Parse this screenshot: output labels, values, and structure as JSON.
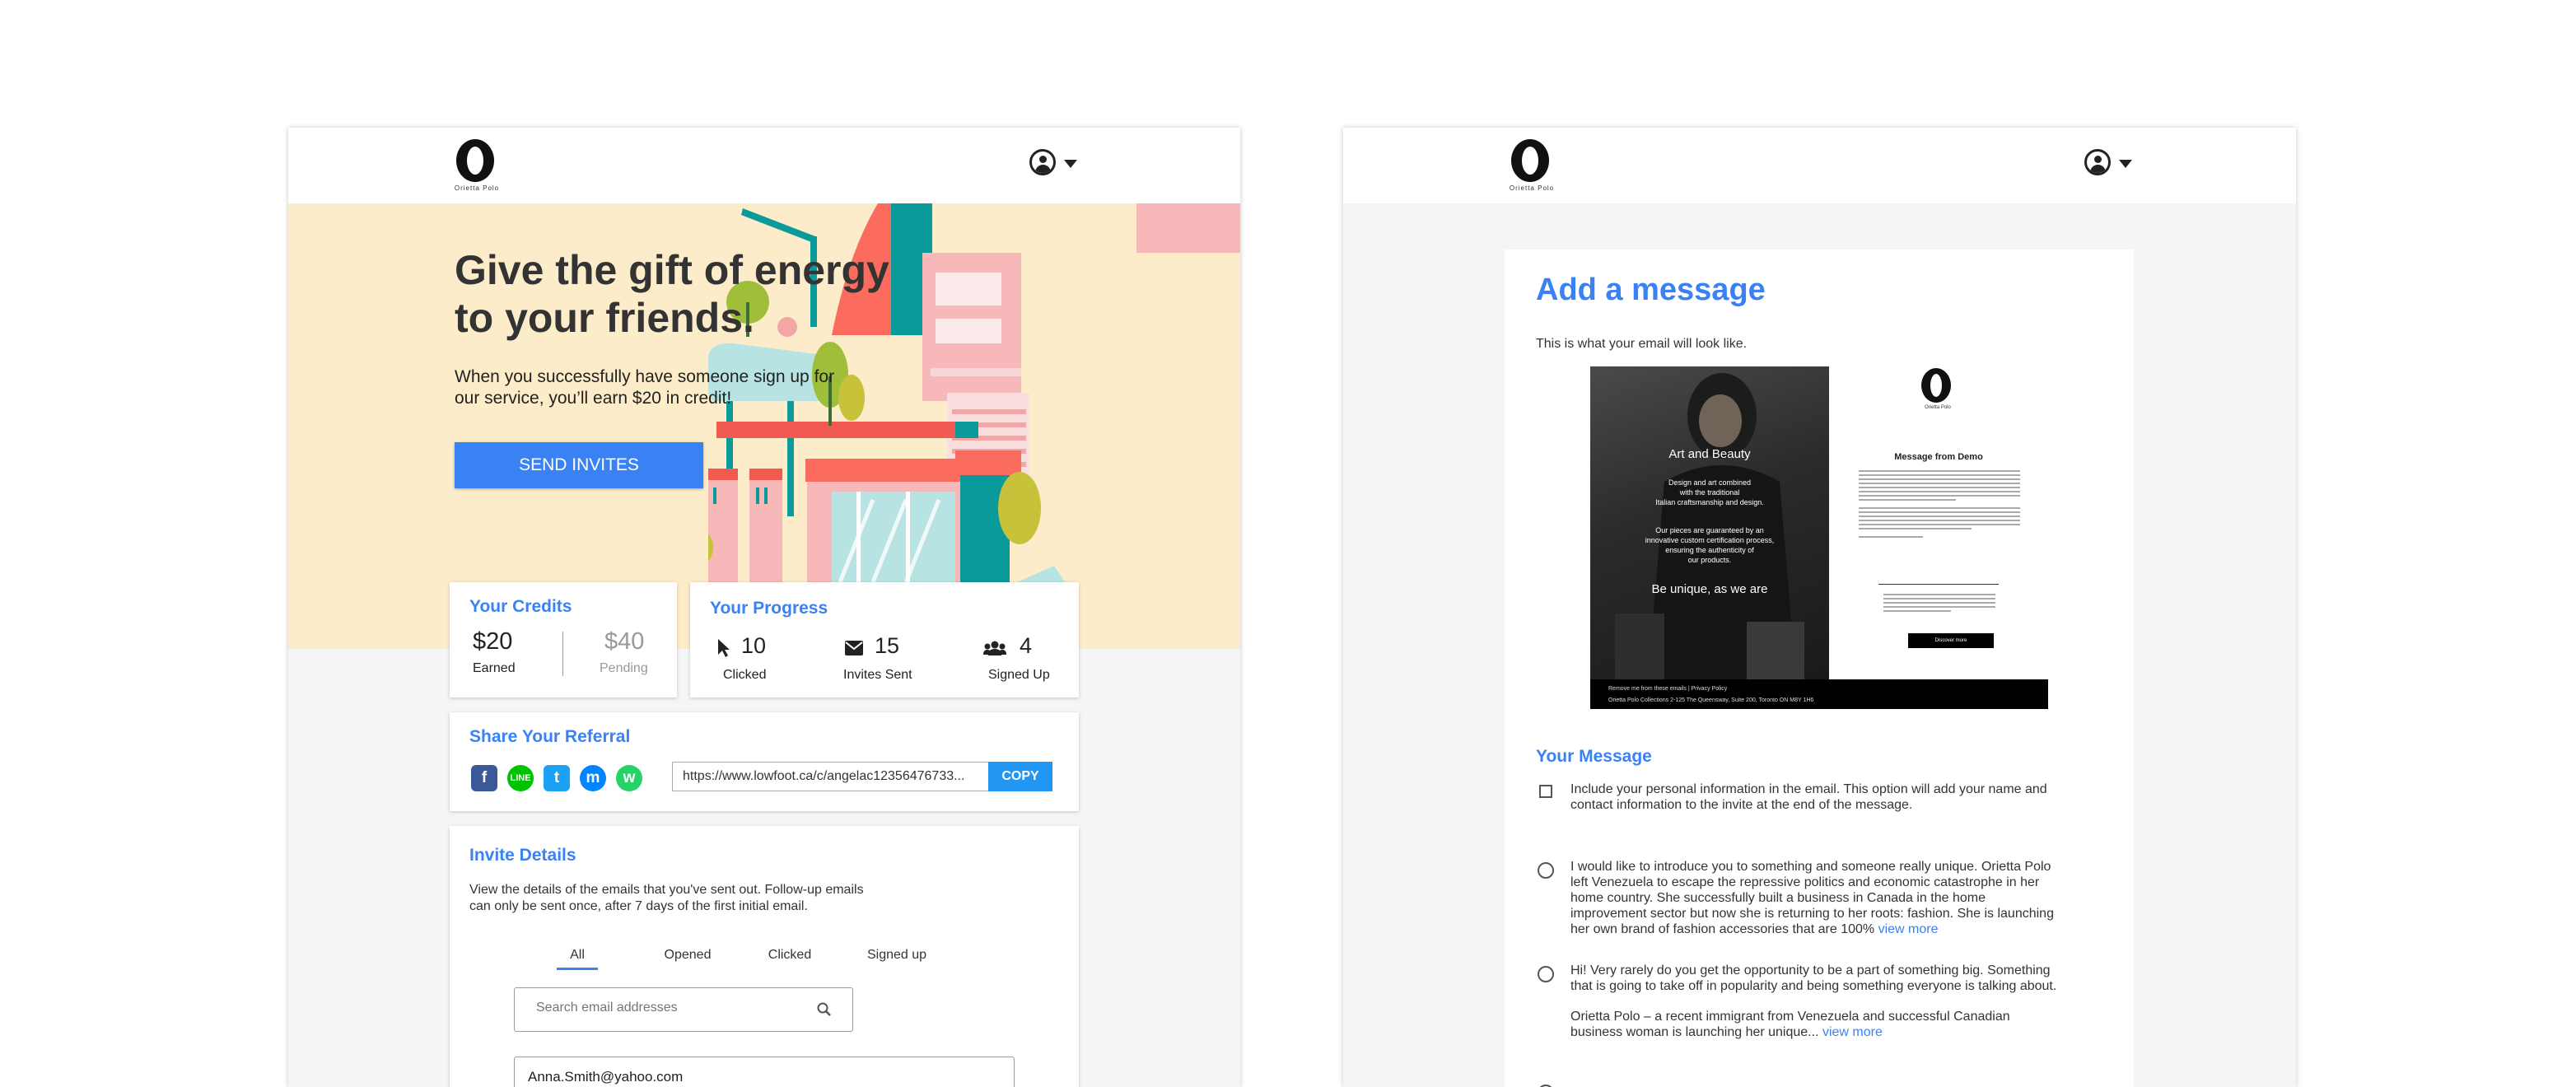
{
  "brand": {
    "name": "Orietta Polo"
  },
  "hero": {
    "title": "Give the gift of energy to your friends.",
    "subtitle": "When you successfully have someone sign up for our service, you’ll earn $20 in credit!",
    "button": "SEND INVITES"
  },
  "credits": {
    "title": "Your Credits",
    "earned_value": "$20",
    "earned_label": "Earned",
    "pending_value": "$40",
    "pending_label": "Pending"
  },
  "progress": {
    "title": "Your Progress",
    "clicked_value": "10",
    "clicked_label": "Clicked",
    "sent_value": "15",
    "sent_label": "Invites Sent",
    "signed_value": "4",
    "signed_label": "Signed Up"
  },
  "referral": {
    "title": "Share Your Referral",
    "url": "https://www.lowfoot.ca/c/angelac12356476733...",
    "copy": "COPY",
    "socials": [
      "facebook",
      "line",
      "twitter",
      "messenger",
      "whatsapp"
    ]
  },
  "invite": {
    "title": "Invite Details",
    "description": "View the details of the emails that you've sent out. Follow-up emails can only be sent once, after 7 days of the first initial email.",
    "tabs": [
      "All",
      "Opened",
      "Clicked",
      "Signed up"
    ],
    "search_placeholder": "Search email addresses",
    "rows": [
      "Anna.Smith@yahoo.com"
    ]
  },
  "message": {
    "title": "Add a message",
    "subtitle": "This is what your email will look like.",
    "preview": {
      "photo_title": "Art and Beauty",
      "photo_line1": "Design and art combined",
      "photo_line2": "with the traditional",
      "photo_line3": "Italian craftsmanship and design.",
      "photo_line4": "Our pieces are guaranteed by an",
      "photo_line5": "innovative custom certification process,",
      "photo_line6": "ensuring the authenticity of",
      "photo_line7": "our products.",
      "photo_slogan": "Be unique, as we are",
      "heading": "Message from Demo",
      "button": "Discover more",
      "footer1": "Remove me from these emails | Privacy Policy",
      "footer2": "Orietta Polo Collections 2-125 The Queensway, Suite 200, Toronto ON M8Y 1H6"
    },
    "section": "Your Message",
    "include_info": "Include your personal information in the email. This option will add your name and contact information to the invite at the end of the message.",
    "option1": "I would like to introduce you to something and someone really unique. Orietta Polo left Venezuela to escape the repressive politics and economic catastrophe in her home country. She successfully built a business in Canada in the home improvement sector but now she is returning to her roots: fashion. She is launching her own brand of fashion accessories that are 100%",
    "option2a": "Hi! Very rarely do you get the opportunity to be a part of something big. Something that is going to take off in popularity and being something everyone is talking about.",
    "option2b": "Orietta Polo – a recent immigrant from Venezuela and successful Canadian business woman is launching her unique...",
    "view_more": "view more"
  },
  "colors": {
    "accent": "#3a82f4",
    "hero_bg": "#fcecc9",
    "copy_button": "#2196f3"
  },
  "icons": [
    "user-icon",
    "caret-down-icon",
    "cursor-icon",
    "envelope-icon",
    "users-icon",
    "search-icon"
  ]
}
